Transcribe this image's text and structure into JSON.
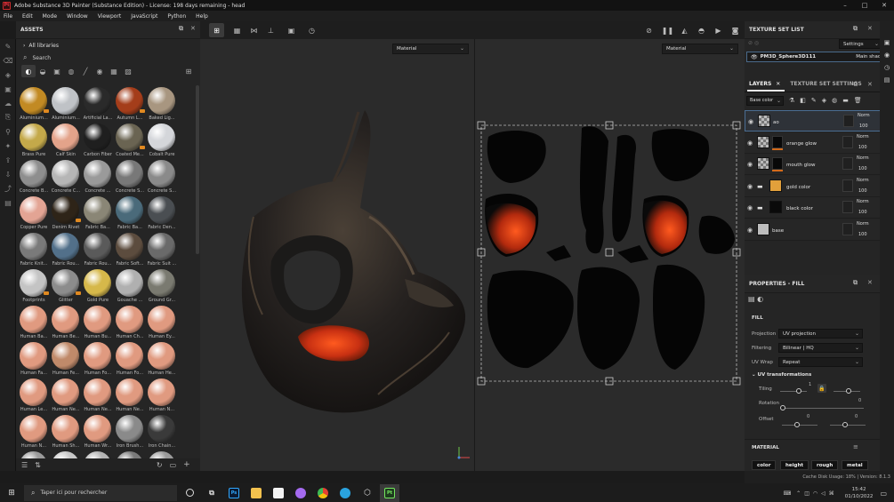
{
  "app": {
    "title": "Adobe Substance 3D Painter (Substance Edition) - License: 198 days remaining - head",
    "logo": "Pt",
    "win_controls": {
      "minimize": "–",
      "maximize": "□",
      "close": "✕"
    }
  },
  "menu": [
    "File",
    "Edit",
    "Mode",
    "Window",
    "Viewport",
    "JavaScript",
    "Python",
    "Help"
  ],
  "assets": {
    "title": "ASSETS",
    "library": "All libraries",
    "search_placeholder": "Search",
    "items": [
      {
        "label": "Aluminium...",
        "color": "#c28a23",
        "badge": true
      },
      {
        "label": "Aluminium...",
        "color": "#bfc2c6",
        "badge": false
      },
      {
        "label": "Artificial La...",
        "color": "#2a2a2a",
        "badge": false
      },
      {
        "label": "Autumn L...",
        "color": "#a43d1a",
        "badge": true
      },
      {
        "label": "Baked Lig...",
        "color": "#a89680",
        "badge": false
      },
      {
        "label": "Brass Pure",
        "color": "#c4a94a",
        "badge": false
      },
      {
        "label": "Calf Skin",
        "color": "#e3a38a",
        "badge": false
      },
      {
        "label": "Carbon Fiber",
        "color": "#1f1f1f",
        "badge": false
      },
      {
        "label": "Coated Me...",
        "color": "#6a6452",
        "badge": true
      },
      {
        "label": "Cobalt Pure",
        "color": "#d4d6da",
        "badge": false
      },
      {
        "label": "Concrete B...",
        "color": "#8e8e8e",
        "badge": false
      },
      {
        "label": "Concrete C...",
        "color": "#b6b6b6",
        "badge": false
      },
      {
        "label": "Concrete ...",
        "color": "#9a9a9a",
        "badge": false
      },
      {
        "label": "Concrete S...",
        "color": "#787878",
        "badge": false
      },
      {
        "label": "Concrete S...",
        "color": "#8a8a8a",
        "badge": false
      },
      {
        "label": "Copper Pure",
        "color": "#e3a494",
        "badge": false
      },
      {
        "label": "Denim Rivet",
        "color": "#2e2418",
        "badge": true
      },
      {
        "label": "Fabric Ba...",
        "color": "#8a8676",
        "badge": false
      },
      {
        "label": "Fabric Ba...",
        "color": "#4a6a7a",
        "badge": false
      },
      {
        "label": "Fabric Den...",
        "color": "#4a4e52",
        "badge": false
      },
      {
        "label": "Fabric Knit...",
        "color": "#7a7a7a",
        "badge": false
      },
      {
        "label": "Fabric Rou...",
        "color": "#52708a",
        "badge": false
      },
      {
        "label": "Fabric Rou...",
        "color": "#5a5a5a",
        "badge": false
      },
      {
        "label": "Fabric Soft...",
        "color": "#5c4c3e",
        "badge": false
      },
      {
        "label": "Fabric Suit ...",
        "color": "#6a6a6a",
        "badge": false
      },
      {
        "label": "Footprints",
        "color": "#c4c4c4",
        "badge": true
      },
      {
        "label": "Glitter",
        "color": "#8c8c8c",
        "badge": true
      },
      {
        "label": "Gold Pure",
        "color": "#d6b84a",
        "badge": false
      },
      {
        "label": "Gouache ...",
        "color": "#b0b0b0",
        "badge": false
      },
      {
        "label": "Ground Gr...",
        "color": "#7a7a70",
        "badge": false
      },
      {
        "label": "Human Ba...",
        "color": "#e09a80",
        "badge": false
      },
      {
        "label": "Human Be...",
        "color": "#e09a80",
        "badge": false
      },
      {
        "label": "Human Bu...",
        "color": "#e09a80",
        "badge": false
      },
      {
        "label": "Human Ch...",
        "color": "#e09a80",
        "badge": false
      },
      {
        "label": "Human Ey...",
        "color": "#e09a80",
        "badge": false
      },
      {
        "label": "Human Fa...",
        "color": "#e09a80",
        "badge": false
      },
      {
        "label": "Human Fe...",
        "color": "#c08a6a",
        "badge": false
      },
      {
        "label": "Human Fo...",
        "color": "#e09a80",
        "badge": false
      },
      {
        "label": "Human Fo...",
        "color": "#e09a80",
        "badge": false
      },
      {
        "label": "Human He...",
        "color": "#e09a80",
        "badge": false
      },
      {
        "label": "Human Le...",
        "color": "#e09a80",
        "badge": false
      },
      {
        "label": "Human Ne...",
        "color": "#e09a80",
        "badge": false
      },
      {
        "label": "Human Ne...",
        "color": "#e09a80",
        "badge": false
      },
      {
        "label": "Human Ne...",
        "color": "#e09a80",
        "badge": false
      },
      {
        "label": "Human N...",
        "color": "#e09a80",
        "badge": false
      },
      {
        "label": "Human N...",
        "color": "#e09a80",
        "badge": false
      },
      {
        "label": "Human Sh...",
        "color": "#e09a80",
        "badge": false
      },
      {
        "label": "Human Wr...",
        "color": "#e09a80",
        "badge": false
      },
      {
        "label": "Iron Brush...",
        "color": "#8a8a8a",
        "badge": false
      },
      {
        "label": "Iron Chain...",
        "color": "#3a3a3a",
        "badge": false
      },
      {
        "label": "",
        "color": "#9a9a9a",
        "badge": false
      },
      {
        "label": "",
        "color": "#c8c8c8",
        "badge": false
      },
      {
        "label": "",
        "color": "#b4b4b4",
        "badge": false
      },
      {
        "label": "",
        "color": "#7a7a7a",
        "badge": false
      },
      {
        "label": "",
        "color": "#9a9a9a",
        "badge": false
      }
    ]
  },
  "viewport": {
    "left_mode": "Material",
    "right_mode": "Material"
  },
  "texture_set_list": {
    "title": "TEXTURE SET LIST",
    "settings_label": "Settings",
    "set_name": "PM3D_Sphere3D111",
    "shader": "Main shader"
  },
  "layers": {
    "tab_layers": "LAYERS",
    "tab_settings": "TEXTURE SET SETTINGS",
    "channel": "Base color",
    "items": [
      {
        "name": "ao",
        "blend": "Norm",
        "opacity": "100",
        "thumb": "checker",
        "selected": true,
        "has_mask": false,
        "folder": false,
        "thumb_color": ""
      },
      {
        "name": "orange glow",
        "blend": "Norm",
        "opacity": "100",
        "thumb": "checker",
        "selected": false,
        "has_mask": true,
        "folder": false,
        "thumb_color": ""
      },
      {
        "name": "mouth glow",
        "blend": "Norm",
        "opacity": "100",
        "thumb": "checker",
        "selected": false,
        "has_mask": true,
        "folder": false,
        "thumb_color": ""
      },
      {
        "name": "gold color",
        "blend": "Norm",
        "opacity": "100",
        "thumb": "color",
        "selected": false,
        "has_mask": false,
        "folder": true,
        "thumb_color": "#e2a03b"
      },
      {
        "name": "black color",
        "blend": "Norm",
        "opacity": "100",
        "thumb": "color",
        "selected": false,
        "has_mask": false,
        "folder": true,
        "thumb_color": "#0a0a0a"
      },
      {
        "name": "base",
        "blend": "Norm",
        "opacity": "100",
        "thumb": "color",
        "selected": false,
        "has_mask": false,
        "folder": false,
        "thumb_color": "#bdbdbd"
      }
    ]
  },
  "properties": {
    "title": "PROPERTIES - FILL",
    "section_fill": "FILL",
    "projection_label": "Projection",
    "projection_value": "UV projection",
    "filtering_label": "Filtering",
    "filtering_value": "Bilinear | HQ",
    "uvwrap_label": "UV Wrap",
    "uvwrap_value": "Repeat",
    "uv_transformations": "UV transformations",
    "tiling_label": "Tiling",
    "tiling_value": "1",
    "rotation_label": "Rotation",
    "rotation_value": "0",
    "offset_label": "Offset",
    "offset_x": "0",
    "offset_y": "0",
    "section_material": "MATERIAL",
    "channels": [
      "color",
      "height",
      "rough",
      "metal"
    ]
  },
  "status": {
    "text": "Cache Disk Usage:  18% | Version: 8.1.3"
  },
  "taskbar": {
    "search_placeholder": "Taper ici pour rechercher",
    "time": "15:42",
    "date": "01/10/2022"
  },
  "colors": {
    "accent": "#4a6d92",
    "orange": "#e08920",
    "glow": "#e0501a"
  }
}
